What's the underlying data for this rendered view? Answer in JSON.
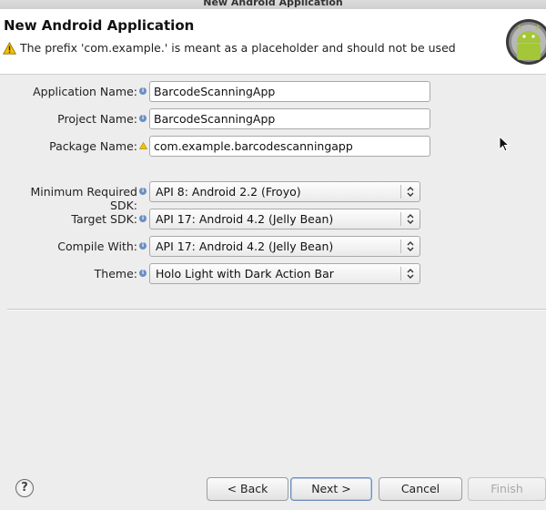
{
  "window": {
    "title": "New Android Application"
  },
  "banner": {
    "title": "New Android Application",
    "message": "The prefix 'com.example.' is meant as a placeholder and should not be used",
    "message_icon": "warning-icon",
    "logo": "android-logo"
  },
  "form": {
    "application_name": {
      "label": "Application Name:",
      "value": "BarcodeScanningApp",
      "icon": "info-icon"
    },
    "project_name": {
      "label": "Project Name:",
      "value": "BarcodeScanningApp",
      "icon": "info-icon"
    },
    "package_name": {
      "label": "Package Name:",
      "value": "com.example.barcodescanningapp",
      "icon": "warning-icon"
    },
    "min_sdk": {
      "label": "Minimum Required SDK:",
      "value": "API 8: Android 2.2 (Froyo)",
      "icon": "info-icon"
    },
    "target_sdk": {
      "label": "Target SDK:",
      "value": "API 17: Android 4.2 (Jelly Bean)",
      "icon": "info-icon"
    },
    "compile_with": {
      "label": "Compile With:",
      "value": "API 17: Android 4.2 (Jelly Bean)",
      "icon": "info-icon"
    },
    "theme": {
      "label": "Theme:",
      "value": "Holo Light with Dark Action Bar",
      "icon": "info-icon"
    }
  },
  "footer": {
    "help": "?",
    "back_label": "< Back",
    "next_label": "Next >",
    "cancel_label": "Cancel",
    "finish_label": "Finish"
  },
  "colors": {
    "android_green": "#a4c639",
    "info_blue": "#6a8fc4",
    "warning_yellow": "#f2c200"
  }
}
